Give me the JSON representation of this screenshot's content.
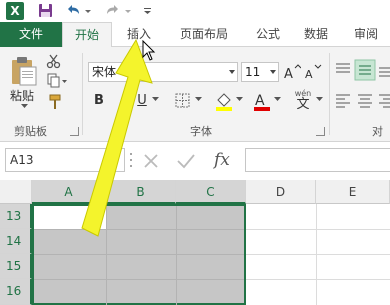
{
  "quick_access": {
    "app_icon": "excel-logo-icon",
    "app_letter": "X",
    "save": "save-icon",
    "undo": "undo-icon",
    "redo": "redo-icon",
    "customize": "qat-dropdown-icon"
  },
  "tabs": [
    "文件",
    "开始",
    "插入",
    "页面布局",
    "公式",
    "数据",
    "审阅"
  ],
  "active_tab": "开始",
  "ribbon": {
    "clipboard": {
      "paste_label": "粘贴",
      "group_label": "剪贴板"
    },
    "font": {
      "font_name": "宋体",
      "font_size": "11",
      "bold": "B",
      "underline": "U",
      "group_label": "字体",
      "wen": "wén"
    },
    "alignment": {
      "group_label": "对"
    }
  },
  "formula_bar": {
    "name_box": "A13",
    "fx": "fx"
  },
  "sheet": {
    "columns": [
      "A",
      "B",
      "C",
      "D",
      "E"
    ],
    "rows": [
      "13",
      "14",
      "15",
      "16"
    ],
    "selected_range": "A13:C16",
    "active_cell": "A13"
  },
  "colors": {
    "accent": "#217346",
    "selection": "#c6c6c6",
    "arrow": "#f4f42c"
  }
}
